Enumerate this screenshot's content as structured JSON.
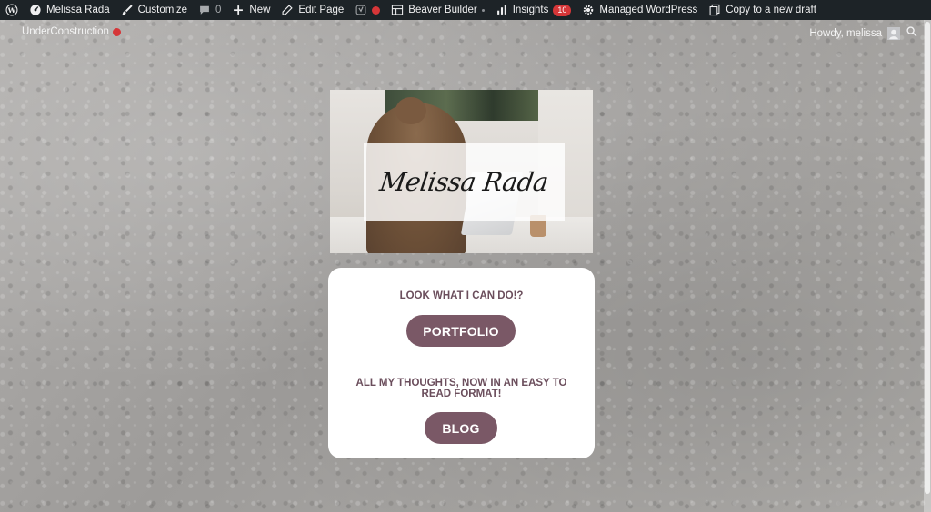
{
  "admin_bar": {
    "site_name": "Melissa Rada",
    "customize": "Customize",
    "comments_count": "0",
    "new": "New",
    "edit_page": "Edit Page",
    "beaver_builder": "Beaver Builder",
    "insights": "Insights",
    "insights_badge": "10",
    "managed_wordpress": "Managed WordPress",
    "copy_draft": "Copy to a new draft"
  },
  "sub_bar": {
    "under_construction": "UnderConstruction",
    "howdy": "Howdy, melissa"
  },
  "hero": {
    "signature": "Melissa Rada"
  },
  "card": {
    "heading_1": "LOOK WHAT I CAN DO!?",
    "button_1": "PORTFOLIO",
    "heading_2": "ALL MY THOUGHTS, NOW IN AN EASY TO READ FORMAT!",
    "button_2": "BLOG"
  },
  "colors": {
    "admin_bg": "#1d2327",
    "accent": "#7a5866",
    "heading_text": "#6b4e5c",
    "badge": "#d63638"
  }
}
